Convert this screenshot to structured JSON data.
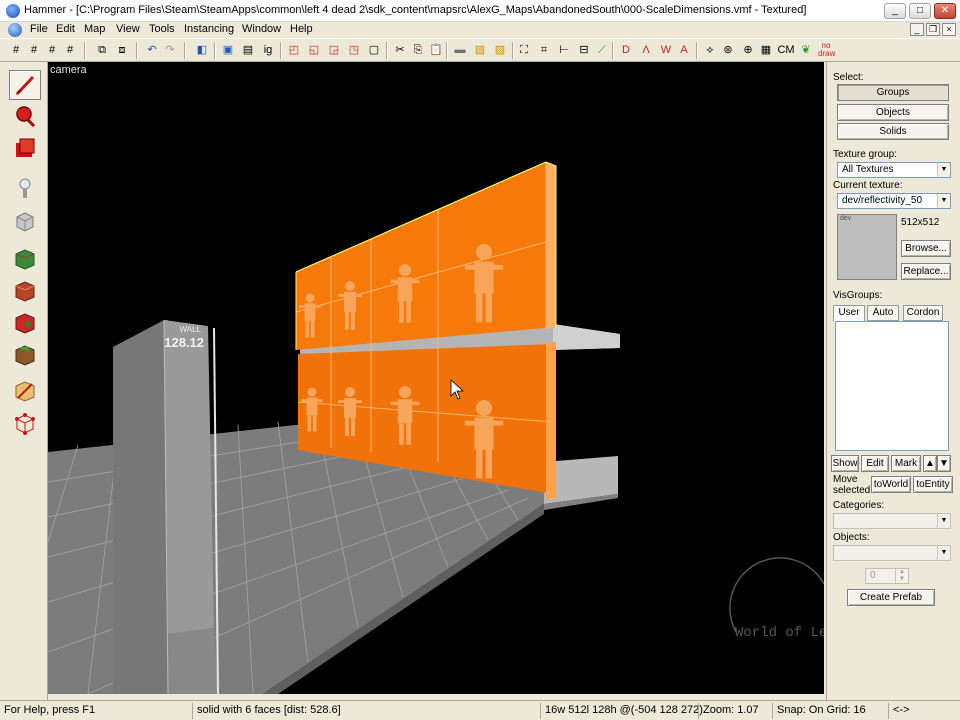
{
  "window": {
    "title": "Hammer - [C:\\Program Files\\Steam\\SteamApps\\common\\left 4 dead 2\\sdk_content\\mapsrc\\AlexG_Maps\\AbandonedSouth\\000-ScaleDimensions.vmf - Textured]"
  },
  "menu": [
    "File",
    "Edit",
    "Map",
    "View",
    "Tools",
    "Instancing",
    "Window",
    "Help"
  ],
  "toolbar": {
    "cm_label": "CM"
  },
  "viewport": {
    "label": "camera",
    "wall_sign_top": "WALL",
    "wall_sign_number": "128.12",
    "watermark": "World of Level Design"
  },
  "right_panel": {
    "select_label": "Select:",
    "select_buttons": [
      "Groups",
      "Objects",
      "Solids"
    ],
    "texture_group_label": "Texture group:",
    "texture_group_value": "All Textures",
    "current_texture_label": "Current texture:",
    "current_texture_value": "dev/reflectivity_50",
    "texture_size": "512x512",
    "browse": "Browse...",
    "replace": "Replace...",
    "visgroups_label": "VisGroups:",
    "vis_tabs": [
      "User",
      "Auto",
      "Cordon"
    ],
    "show": "Show",
    "edit": "Edit",
    "mark": "Mark",
    "move_selected": "Move selected:",
    "to_world": "toWorld",
    "to_entity": "toEntity",
    "categories_label": "Categories:",
    "objects_label": "Objects:",
    "spinner_value": "0",
    "create_prefab": "Create Prefab"
  },
  "status": {
    "help": "For Help, press F1",
    "selection": "solid with 6 faces  [dist: 528.6]",
    "size": "16w 512l 128h @(-504 128 272)",
    "zoom": "Zoom: 1.07",
    "snap": "Snap: On Grid: 16",
    "extra": "<->"
  },
  "colors": {
    "orange": "#ff7a00",
    "accent_blue": "#2157b8"
  }
}
